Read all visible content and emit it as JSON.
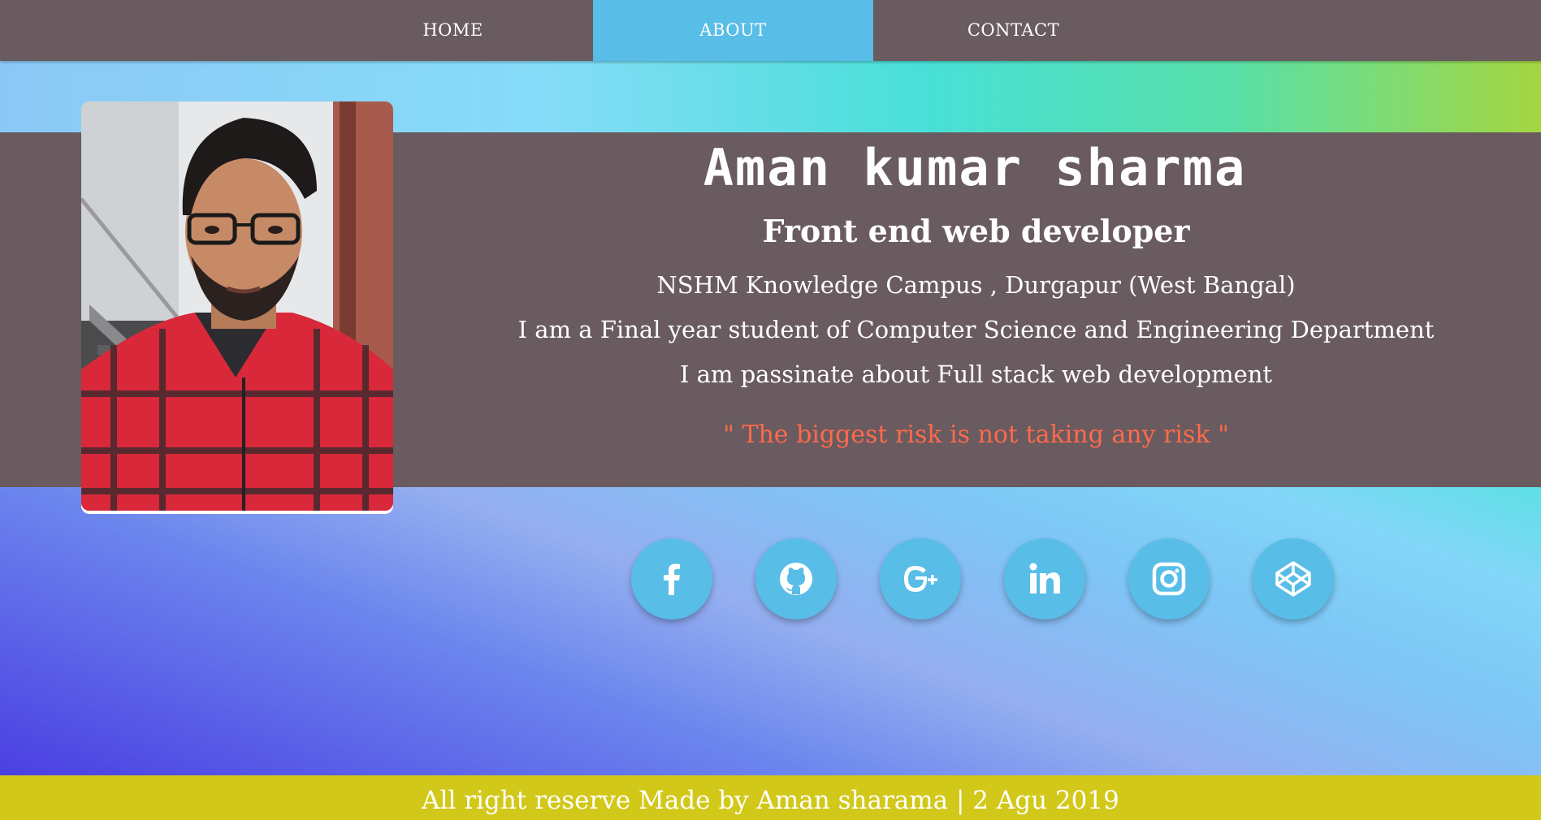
{
  "nav": {
    "items": [
      {
        "label": "HOME"
      },
      {
        "label": "ABOUT"
      },
      {
        "label": "CONTACT"
      }
    ],
    "active": "ABOUT"
  },
  "profile": {
    "name": "Aman kumar sharma",
    "role": "Front end web developer",
    "college": "NSHM Knowledge Campus , Durgapur (West Bangal)",
    "study": "I am a Final year student of Computer Science and Engineering Department",
    "passion": "I am passinate about Full stack web development",
    "quote": "\" The biggest risk is not taking any risk \""
  },
  "social": [
    {
      "icon": "facebook-icon"
    },
    {
      "icon": "github-icon"
    },
    {
      "icon": "google-plus-icon"
    },
    {
      "icon": "linkedin-icon"
    },
    {
      "icon": "instagram-icon"
    },
    {
      "icon": "codepen-icon"
    }
  ],
  "footer": {
    "text": "All right reserve Made by Aman sharama | 2 Agu 2019"
  },
  "colors": {
    "nav_bg": "#695b5f",
    "accent": "#58bde7",
    "quote": "#ff6a4c",
    "footer_bg": "#d2c81a"
  }
}
